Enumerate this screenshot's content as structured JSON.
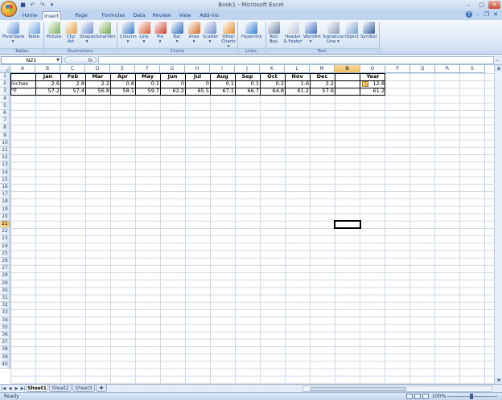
{
  "window": {
    "title": "Book1 - Microsoft Excel"
  },
  "qat": [
    "save-icon",
    "undo-icon",
    "redo-icon",
    "customize-icon"
  ],
  "tabs": [
    "Home",
    "Insert",
    "Page Layout",
    "Formulas",
    "Data",
    "Review",
    "View",
    "Add-Ins"
  ],
  "active_tab": "Insert",
  "ribbon": {
    "buttons": [
      {
        "label": "PivotTable",
        "sub": "▾",
        "icon": "pivottable-icon"
      },
      {
        "label": "Table",
        "sub": "",
        "icon": "table-icon"
      },
      {
        "label": "Picture",
        "sub": "",
        "icon": "picture-icon"
      },
      {
        "label": "Clip",
        "sub": "Art",
        "icon": "clipart-icon"
      },
      {
        "label": "Shapes",
        "sub": "▾",
        "icon": "shapes-icon"
      },
      {
        "label": "SmartArt",
        "sub": "",
        "icon": "smartart-icon"
      },
      {
        "label": "Column",
        "sub": "▾",
        "icon": "column-chart-icon"
      },
      {
        "label": "Line",
        "sub": "▾",
        "icon": "line-chart-icon"
      },
      {
        "label": "Pie",
        "sub": "▾",
        "icon": "pie-chart-icon"
      },
      {
        "label": "Bar",
        "sub": "▾",
        "icon": "bar-chart-icon"
      },
      {
        "label": "Area",
        "sub": "▾",
        "icon": "area-chart-icon"
      },
      {
        "label": "Scatter",
        "sub": "▾",
        "icon": "scatter-chart-icon"
      },
      {
        "label": "Other",
        "sub": "Charts ▾",
        "icon": "other-charts-icon"
      },
      {
        "label": "Hyperlink",
        "sub": "",
        "icon": "hyperlink-icon"
      },
      {
        "label": "Text",
        "sub": "Box",
        "icon": "textbox-icon"
      },
      {
        "label": "Header",
        "sub": "& Footer",
        "icon": "header-footer-icon"
      },
      {
        "label": "WordArt",
        "sub": "▾",
        "icon": "wordart-icon"
      },
      {
        "label": "Signature",
        "sub": "Line ▾",
        "icon": "signature-icon"
      },
      {
        "label": "Object",
        "sub": "",
        "icon": "object-icon"
      },
      {
        "label": "Symbol",
        "sub": "",
        "icon": "symbol-icon"
      }
    ],
    "groups": [
      "Tables",
      "Illustrations",
      "Charts",
      "Links",
      "Text"
    ]
  },
  "formula_bar": {
    "name_box": "N21",
    "fx": "fx",
    "formula": ""
  },
  "columns": [
    "A",
    "B",
    "C",
    "D",
    "E",
    "F",
    "G",
    "H",
    "I",
    "J",
    "K",
    "L",
    "M",
    "N",
    "O",
    "P",
    "Q",
    "R",
    "S"
  ],
  "selected_column": "N",
  "rows_count": 40,
  "selected_row": 21,
  "cells": {
    "row1": [
      "",
      "Jan",
      "Feb",
      "Mar",
      "Apr",
      "May",
      "Jun",
      "Jul",
      "Aug",
      "Sep",
      "Oct",
      "Nov",
      "Dec",
      "",
      "Year"
    ],
    "row2": [
      "inches",
      "2.6",
      "2.8",
      "2.2",
      "0.8",
      "0.1",
      "0",
      "0",
      "0.1",
      "0.1",
      "0.2",
      "1.6",
      "2.2",
      "",
      "12.8"
    ],
    "row3": [
      "°F",
      "57.2",
      "57.4",
      "56.8",
      "58.1",
      "59.7",
      "62.2",
      "65.5",
      "67.1",
      "66.7",
      "64.8",
      "61.2",
      "57.6",
      "",
      "61.2"
    ]
  },
  "sheets": [
    "Sheet1",
    "Sheet2",
    "Sheet3"
  ],
  "active_sheet": "Sheet1",
  "status": {
    "text": "Ready",
    "zoom": "100%"
  }
}
